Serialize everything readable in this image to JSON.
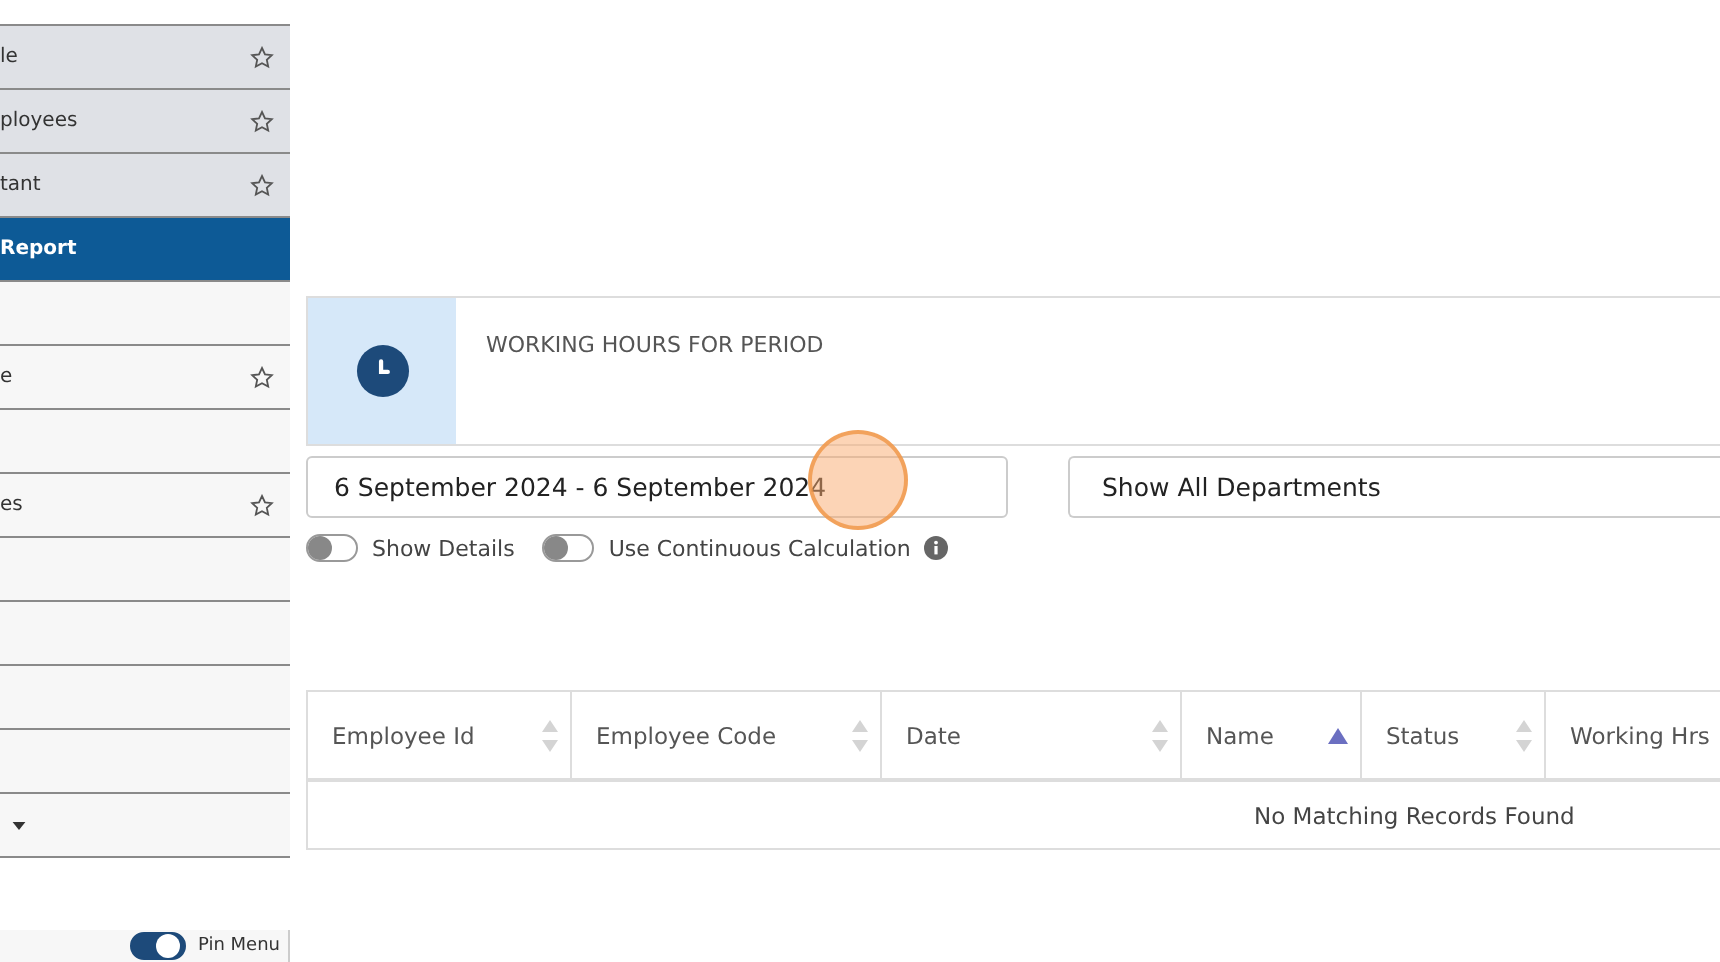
{
  "sidebar": {
    "items": [
      {
        "label": "le",
        "starred": true,
        "selected": false,
        "kind": "group"
      },
      {
        "label": "ployees",
        "starred": true,
        "selected": false,
        "kind": "group"
      },
      {
        "label": "tant",
        "starred": true,
        "selected": false,
        "kind": "group"
      },
      {
        "label": "Report",
        "starred": false,
        "selected": true,
        "kind": "group"
      },
      {
        "starred": false,
        "selected": false,
        "kind": "link"
      },
      {
        "label": "e",
        "starred": true,
        "selected": false,
        "kind": "link"
      },
      {
        "starred": false,
        "selected": false,
        "kind": "link"
      },
      {
        "label": "es",
        "starred": true,
        "selected": false,
        "kind": "link"
      },
      {
        "starred": false,
        "selected": false,
        "kind": "link"
      },
      {
        "starred": false,
        "selected": false,
        "kind": "link"
      },
      {
        "starred": false,
        "selected": false,
        "kind": "link"
      },
      {
        "starred": false,
        "selected": false,
        "kind": "link"
      },
      {
        "starred": false,
        "selected": false,
        "kind": "dropdown"
      }
    ],
    "pin_menu": {
      "label": "Pin Menu",
      "on": true
    }
  },
  "card": {
    "title": "WORKING HOURS FOR PERIOD"
  },
  "filters": {
    "date_range": "6 September 2024 - 6 September 2024",
    "department": "Show All Departments"
  },
  "toggles": [
    {
      "label": "Show Details",
      "on": false,
      "info": false
    },
    {
      "label": "Use Continuous Calculation",
      "on": false,
      "info": true
    }
  ],
  "table": {
    "columns": [
      {
        "label": "Employee Id",
        "sorted": false
      },
      {
        "label": "Employee Code",
        "sorted": false
      },
      {
        "label": "Date",
        "sorted": false
      },
      {
        "label": "Name",
        "sorted": true
      },
      {
        "label": "Status",
        "sorted": false
      },
      {
        "label": "Working Hrs"
      }
    ],
    "empty_message": "No Matching Records Found"
  }
}
